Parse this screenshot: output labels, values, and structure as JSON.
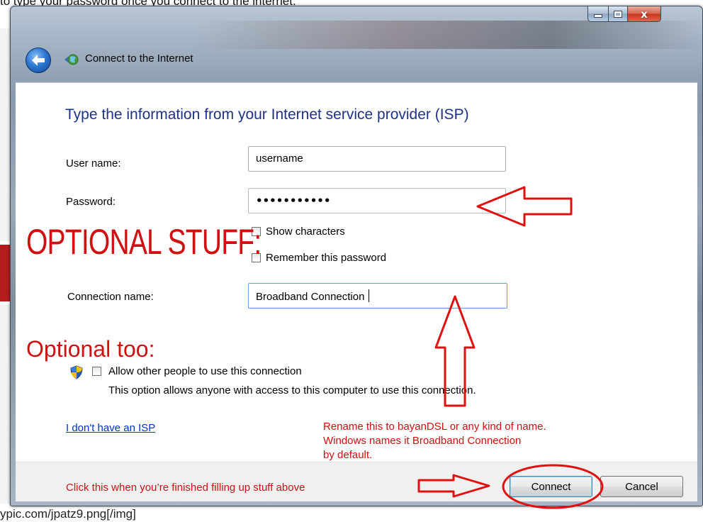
{
  "background": {
    "top_text": "to type your password once you connect to the internet.",
    "bottom_text": "ypic.com/jpatz9.png[/img]"
  },
  "window": {
    "title": "Connect to the Internet",
    "caption_buttons": {
      "minimize": "–",
      "maximize": "□",
      "close": "x"
    }
  },
  "form": {
    "heading": "Type the information from your Internet service provider (ISP)",
    "username_label": "User name:",
    "username_value": "username",
    "password_label": "Password:",
    "password_value": "•••••••••••",
    "show_characters_label": "Show characters",
    "remember_password_label": "Remember this password",
    "connection_name_label": "Connection name:",
    "connection_name_value": "Broadband Connection",
    "allow_others_label": "Allow other people to use this connection",
    "allow_others_desc": "This option allows anyone with access to this computer to use this connection.",
    "no_isp_link": "I don't have an ISP"
  },
  "buttons": {
    "connect": "Connect",
    "cancel": "Cancel"
  },
  "annotations": {
    "optional_stuff": "OPTIONAL STUFF:",
    "optional_too": "Optional too:",
    "rename_line1": "Rename this to bayanDSL or any kind of name.",
    "rename_line2": "Windows names it Broadband Connection",
    "rename_line3": "by default.",
    "click_hint": "Click this when you’re finished filling up stuff above"
  },
  "colors": {
    "annotation_red": "#d01010",
    "heading_blue": "#1e3287",
    "link_blue": "#0033cc"
  }
}
